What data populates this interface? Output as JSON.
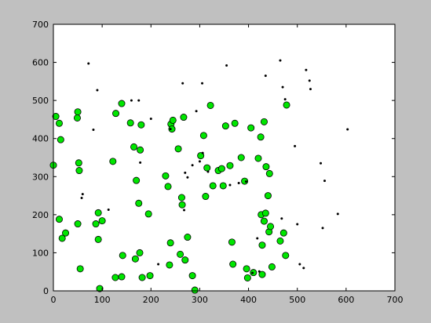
{
  "chart_data": {
    "type": "scatter",
    "title": "",
    "xlabel": "",
    "ylabel": "",
    "xlim": [
      0,
      700
    ],
    "ylim": [
      0,
      700
    ],
    "x_ticks": [
      0,
      100,
      200,
      300,
      400,
      500,
      600,
      700
    ],
    "y_ticks": [
      0,
      100,
      200,
      300,
      400,
      500,
      600,
      700
    ],
    "grid": false,
    "legend": "none",
    "colors": {
      "background": "#c0c0c0",
      "plot_area": "#ffffff",
      "axis": "#000000",
      "green_marker_fill": "#00e600",
      "marker_edge": "#000000"
    },
    "series": [
      {
        "marker": "circle",
        "color": "#00e600",
        "points": [
          [
            0,
            330
          ],
          [
            5,
            458
          ],
          [
            12,
            440
          ],
          [
            15,
            397
          ],
          [
            25,
            152
          ],
          [
            18,
            138
          ],
          [
            12,
            188
          ],
          [
            50,
            470
          ],
          [
            49,
            454
          ],
          [
            52,
            336
          ],
          [
            53,
            316
          ],
          [
            50,
            176
          ],
          [
            55,
            58
          ],
          [
            87,
            176
          ],
          [
            92,
            205
          ],
          [
            92,
            135
          ],
          [
            100,
            184
          ],
          [
            95,
            6
          ],
          [
            122,
            340
          ],
          [
            128,
            466
          ],
          [
            127,
            35
          ],
          [
            140,
            492
          ],
          [
            140,
            37
          ],
          [
            142,
            93
          ],
          [
            158,
            441
          ],
          [
            165,
            378
          ],
          [
            170,
            290
          ],
          [
            168,
            84
          ],
          [
            175,
            230
          ],
          [
            180,
            436
          ],
          [
            178,
            370
          ],
          [
            177,
            100
          ],
          [
            182,
            35
          ],
          [
            195,
            202
          ],
          [
            198,
            40
          ],
          [
            230,
            302
          ],
          [
            235,
            274
          ],
          [
            240,
            126
          ],
          [
            238,
            68
          ],
          [
            241,
            438
          ],
          [
            243,
            425
          ],
          [
            245,
            448
          ],
          [
            256,
            373
          ],
          [
            260,
            96
          ],
          [
            263,
            245
          ],
          [
            264,
            226
          ],
          [
            267,
            456
          ],
          [
            270,
            81
          ],
          [
            275,
            141
          ],
          [
            285,
            40
          ],
          [
            290,
            2
          ],
          [
            302,
            355
          ],
          [
            308,
            408
          ],
          [
            312,
            248
          ],
          [
            315,
            323
          ],
          [
            322,
            487
          ],
          [
            327,
            276
          ],
          [
            338,
            316
          ],
          [
            345,
            321
          ],
          [
            348,
            276
          ],
          [
            353,
            433
          ],
          [
            362,
            329
          ],
          [
            366,
            128
          ],
          [
            368,
            70
          ],
          [
            372,
            440
          ],
          [
            385,
            350
          ],
          [
            392,
            288
          ],
          [
            396,
            58
          ],
          [
            398,
            34
          ],
          [
            405,
            428
          ],
          [
            410,
            48
          ],
          [
            420,
            348
          ],
          [
            425,
            404
          ],
          [
            426,
            200
          ],
          [
            428,
            120
          ],
          [
            428,
            43
          ],
          [
            432,
            444
          ],
          [
            432,
            183
          ],
          [
            435,
            204
          ],
          [
            436,
            326
          ],
          [
            440,
            250
          ],
          [
            442,
            155
          ],
          [
            443,
            308
          ],
          [
            445,
            169
          ],
          [
            448,
            63
          ],
          [
            465,
            131
          ],
          [
            472,
            152
          ],
          [
            476,
            93
          ],
          [
            478,
            488
          ]
        ]
      },
      {
        "marker": "point",
        "color": "#000000",
        "points": [
          [
            58,
            244
          ],
          [
            60,
            254
          ],
          [
            72,
            597
          ],
          [
            82,
            423
          ],
          [
            90,
            527
          ],
          [
            113,
            213
          ],
          [
            160,
            500
          ],
          [
            175,
            500
          ],
          [
            178,
            337
          ],
          [
            200,
            452
          ],
          [
            215,
            70
          ],
          [
            240,
            425
          ],
          [
            265,
            545
          ],
          [
            268,
            212
          ],
          [
            270,
            310
          ],
          [
            275,
            298
          ],
          [
            285,
            330
          ],
          [
            293,
            472
          ],
          [
            300,
            340
          ],
          [
            305,
            545
          ],
          [
            306,
            362
          ],
          [
            317,
            313
          ],
          [
            355,
            592
          ],
          [
            362,
            278
          ],
          [
            380,
            283
          ],
          [
            395,
            287
          ],
          [
            408,
            47
          ],
          [
            418,
            138
          ],
          [
            422,
            51
          ],
          [
            435,
            565
          ],
          [
            465,
            605
          ],
          [
            468,
            190
          ],
          [
            470,
            535
          ],
          [
            475,
            503
          ],
          [
            495,
            380
          ],
          [
            500,
            175
          ],
          [
            505,
            70
          ],
          [
            513,
            60
          ],
          [
            518,
            580
          ],
          [
            525,
            552
          ],
          [
            527,
            530
          ],
          [
            548,
            335
          ],
          [
            552,
            165
          ],
          [
            556,
            289
          ],
          [
            583,
            202
          ],
          [
            603,
            424
          ]
        ]
      }
    ]
  }
}
